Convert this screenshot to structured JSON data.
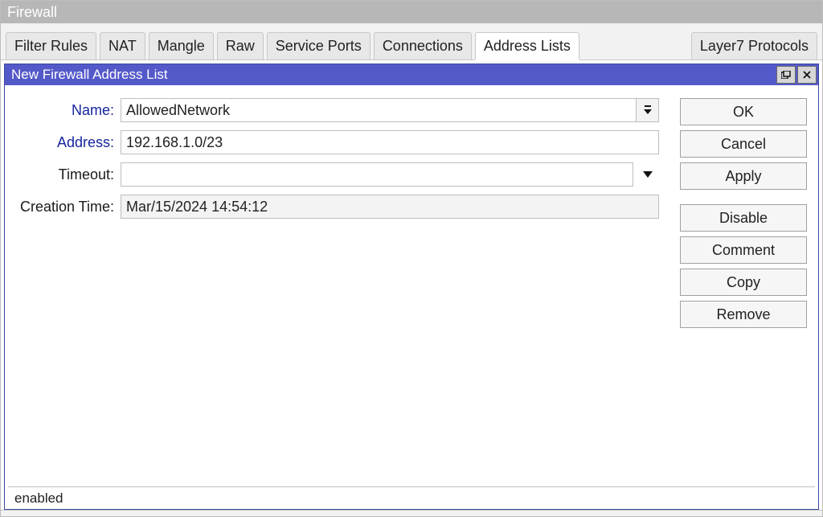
{
  "window": {
    "title": "Firewall"
  },
  "tabs": [
    {
      "label": "Filter Rules"
    },
    {
      "label": "NAT"
    },
    {
      "label": "Mangle"
    },
    {
      "label": "Raw"
    },
    {
      "label": "Service Ports"
    },
    {
      "label": "Connections"
    },
    {
      "label": "Address Lists",
      "active": true
    },
    {
      "label": "Layer7 Protocols"
    }
  ],
  "dialog": {
    "title": "New Firewall Address List",
    "labels": {
      "name": "Name:",
      "address": "Address:",
      "timeout": "Timeout:",
      "creation_time": "Creation Time:"
    },
    "fields": {
      "name": "AllowedNetwork",
      "address": "192.168.1.0/23",
      "timeout": "",
      "creation_time": "Mar/15/2024 14:54:12"
    },
    "buttons": {
      "ok": "OK",
      "cancel": "Cancel",
      "apply": "Apply",
      "disable": "Disable",
      "comment": "Comment",
      "copy": "Copy",
      "remove": "Remove"
    }
  },
  "status": "enabled"
}
